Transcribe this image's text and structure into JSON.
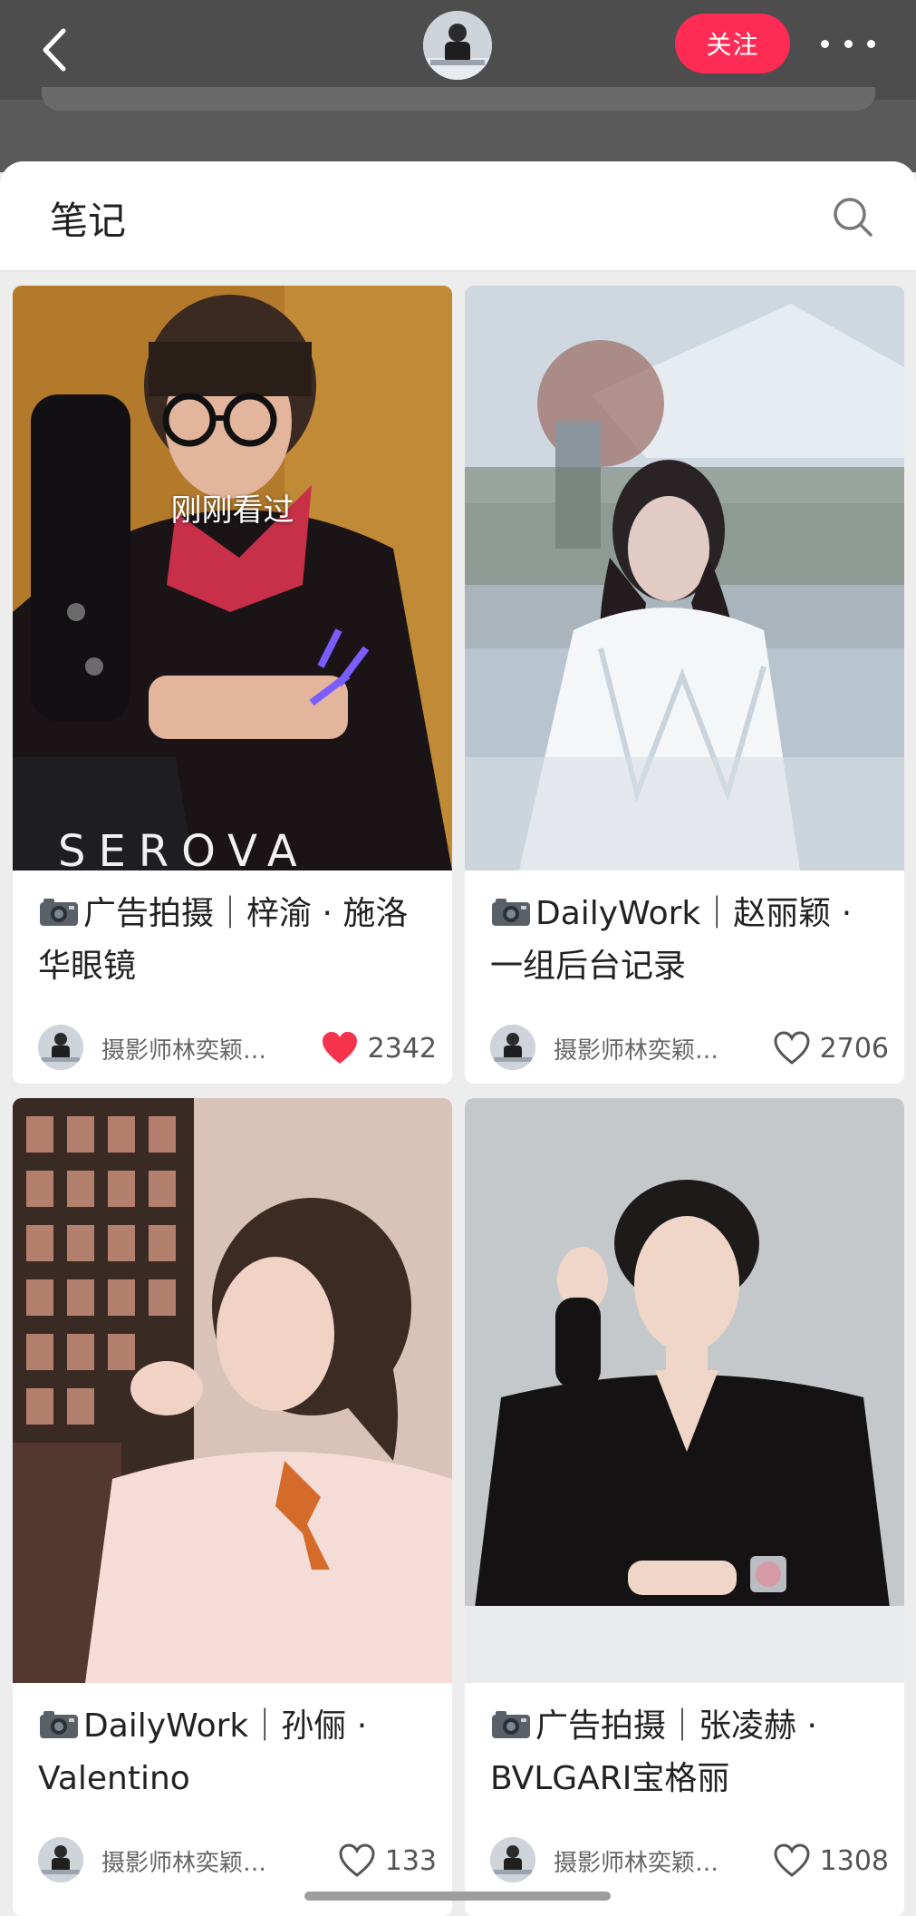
{
  "header": {
    "follow_label": "关注"
  },
  "notes": {
    "title": "笔记",
    "viewed_label": "刚刚看过"
  },
  "cards": [
    {
      "title_text": "广告拍摄｜梓渝 · 施洛华眼镜",
      "author": "摄影师林奕颖…",
      "likes": "2342",
      "liked": true,
      "image_text": "SEROVA"
    },
    {
      "title_text": "DailyWork｜赵丽颖 · 一组后台记录",
      "author": "摄影师林奕颖…",
      "likes": "2706",
      "liked": false
    },
    {
      "title_text": "DailyWork｜孙俪 · Valentino",
      "author": "摄影师林奕颖…",
      "likes": "133",
      "liked": false
    },
    {
      "title_text": "广告拍摄｜张凌赫 · BVLGARI宝格丽",
      "author": "摄影师林奕颖…",
      "likes": "1308",
      "liked": false
    }
  ],
  "colors": {
    "accent": "#fe2c55",
    "heart_liked": "#f5334c"
  },
  "icons": [
    "back-icon",
    "avatar",
    "more-icon",
    "search-icon",
    "camera-icon",
    "heart-icon"
  ]
}
